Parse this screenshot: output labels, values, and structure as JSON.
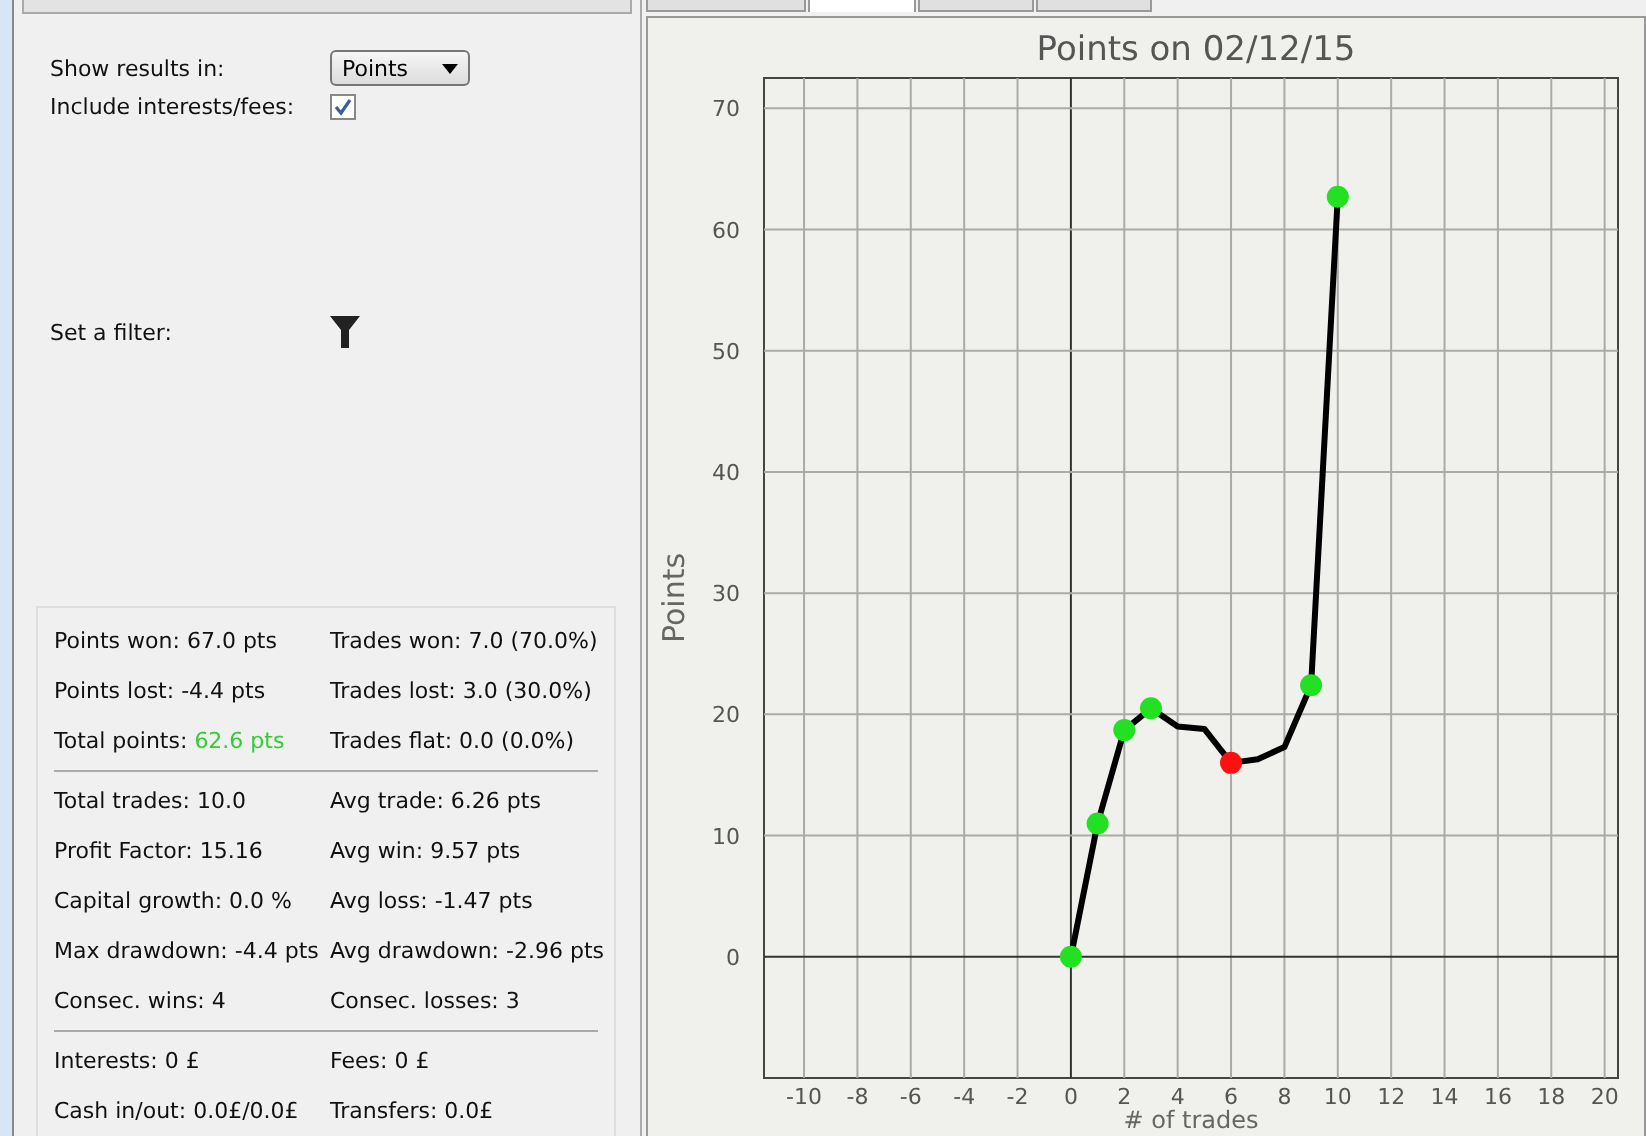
{
  "settings": {
    "show_results_label": "Show results in:",
    "show_results_value": "Points",
    "include_fees_label": "Include interests/fees:",
    "include_fees_checked": true,
    "filter_label": "Set a filter:"
  },
  "tabs": [
    {
      "selected": false
    },
    {
      "selected": true
    },
    {
      "selected": false
    },
    {
      "selected": false
    }
  ],
  "stats": [
    [
      [
        {
          "label": "Points won: ",
          "value": "67.0 pts"
        },
        {
          "label": "Trades won: ",
          "value": "7.0 (70.0%)"
        }
      ],
      [
        {
          "label": "Points lost: ",
          "value": "-4.4 pts"
        },
        {
          "label": "Trades lost: ",
          "value": "3.0 (30.0%)"
        }
      ],
      [
        {
          "label": "Total points: ",
          "value": "62.6 pts",
          "color": "#33cc33"
        },
        {
          "label": "Trades flat: ",
          "value": "0.0 (0.0%)"
        }
      ]
    ],
    [
      [
        {
          "label": "Total trades: ",
          "value": "10.0"
        },
        {
          "label": "Avg trade: ",
          "value": "6.26 pts"
        }
      ],
      [
        {
          "label": "Profit Factor: ",
          "value": "15.16"
        },
        {
          "label": "Avg win: ",
          "value": "9.57 pts"
        }
      ],
      [
        {
          "label": "Capital growth: ",
          "value": "0.0 %"
        },
        {
          "label": "Avg loss: ",
          "value": "-1.47 pts"
        }
      ],
      [
        {
          "label": "Max drawdown: ",
          "value": "-4.4 pts"
        },
        {
          "label": "Avg drawdown: ",
          "value": "-2.96 pts"
        }
      ],
      [
        {
          "label": "Consec. wins: ",
          "value": "4"
        },
        {
          "label": "Consec. losses: ",
          "value": "3"
        }
      ]
    ],
    [
      [
        {
          "label": "Interests: ",
          "value": "0 £"
        },
        {
          "label": "Fees: ",
          "value": "0 £"
        }
      ],
      [
        {
          "label": "Cash in/out: ",
          "value": "0.0£/0.0£"
        },
        {
          "label": "Transfers: ",
          "value": "0.0£"
        }
      ]
    ]
  ],
  "chart": {
    "chart_data": {
      "type": "line",
      "title": "Points on 02/12/15",
      "xlabel": "# of trades",
      "ylabel": "Points",
      "x": [
        0,
        1,
        2,
        3,
        4,
        5,
        6,
        7,
        8,
        9,
        10
      ],
      "series": [
        {
          "color": "#000000",
          "marker": true,
          "values": [
            0,
            11,
            18.7,
            20.5,
            19,
            18.8,
            16,
            16.3,
            17.3,
            22.4,
            62.7
          ]
        }
      ],
      "grid": true,
      "xlim": [
        -11.5,
        20.5
      ],
      "ylim": [
        -10,
        72.5
      ],
      "xticks": [
        -10,
        -8,
        -6,
        -4,
        -2,
        0,
        2,
        4,
        6,
        8,
        10,
        12,
        14,
        16,
        18,
        20
      ],
      "yticks": [
        0,
        10,
        20,
        30,
        40,
        50,
        60,
        70
      ]
    },
    "markers": [
      {
        "kind": "dot",
        "color": "#22e022"
      },
      {
        "kind": "dot",
        "color": "#22e022"
      },
      {
        "kind": "dot",
        "color": "#22e022"
      },
      {
        "kind": "dot",
        "color": "#22e022"
      },
      {
        "kind": "none"
      },
      {
        "kind": "none"
      },
      {
        "kind": "dot",
        "color": "#ff1010"
      },
      {
        "kind": "none"
      },
      {
        "kind": "none"
      },
      {
        "kind": "dot",
        "color": "#22e022"
      },
      {
        "kind": "dot",
        "color": "#22e022"
      }
    ]
  }
}
